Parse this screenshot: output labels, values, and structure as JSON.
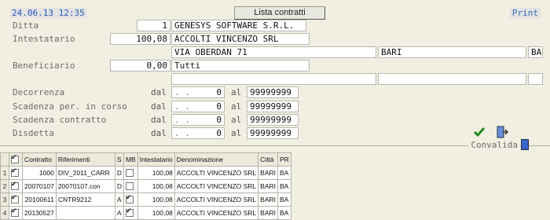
{
  "header": {
    "datetime": "24.06.13 12:35",
    "title": "Lista contratti",
    "print": "Print"
  },
  "form": {
    "ditta": {
      "label": "Ditta",
      "code": "1",
      "name": "GENESYS SOFTWARE S.R.L."
    },
    "intestatario": {
      "label": "Intestatario",
      "code": "100,08",
      "name": "ACCOLTI VINCENZO SRL",
      "address": "VIA OBERDAN 71",
      "city": "BARI",
      "province": "BA"
    },
    "beneficiario": {
      "label": "Beneficiario",
      "code": "0,00",
      "name": "Tutti"
    },
    "dal_label": "dal",
    "al_label": "al",
    "dates": [
      {
        "label": "Decorrenza",
        "dal": "0",
        "al": "99999999"
      },
      {
        "label": "Scadenza per. in corso",
        "dal": "0",
        "al": "99999999"
      },
      {
        "label": "Scadenza contratto",
        "dal": "0",
        "al": "99999999"
      },
      {
        "label": "Disdetta",
        "dal": "0",
        "al": "99999999"
      }
    ],
    "dal_mask": ". ."
  },
  "convalida": {
    "label": "Convalida"
  },
  "table": {
    "columns": [
      "",
      "✔",
      "Contratto",
      "Riferimenti",
      "S",
      "MB",
      "Intestatario",
      "Denominazione",
      "Città",
      "PR"
    ],
    "rows": [
      {
        "n": "1",
        "contratto": "1000",
        "riferimenti": "DIV_2011_CARR",
        "s": "D",
        "mb": false,
        "intestatario": "100,08",
        "denominazione": "ACCOLTI VINCENZO SRL",
        "citta": "BARI",
        "pr": "BA"
      },
      {
        "n": "2",
        "contratto": "20070107",
        "riferimenti": "20070107.con",
        "s": "D",
        "mb": false,
        "intestatario": "100,08",
        "denominazione": "ACCOLTI VINCENZO SRL",
        "citta": "BARI",
        "pr": "BA"
      },
      {
        "n": "3",
        "contratto": "20100611",
        "riferimenti": "CNTR9212",
        "s": "A",
        "mb": true,
        "intestatario": "100,08",
        "denominazione": "ACCOLTI VINCENZO SRL",
        "citta": "BARI",
        "pr": "BA"
      },
      {
        "n": "4",
        "contratto": "20130527",
        "riferimenti": "",
        "s": "A",
        "mb": true,
        "intestatario": "100,08",
        "denominazione": "ACCOLTI VINCENZO SRL",
        "citta": "BARI",
        "pr": "BA"
      }
    ]
  },
  "colors": {
    "accent": "#3a67c8",
    "background": "#f1efe2"
  }
}
